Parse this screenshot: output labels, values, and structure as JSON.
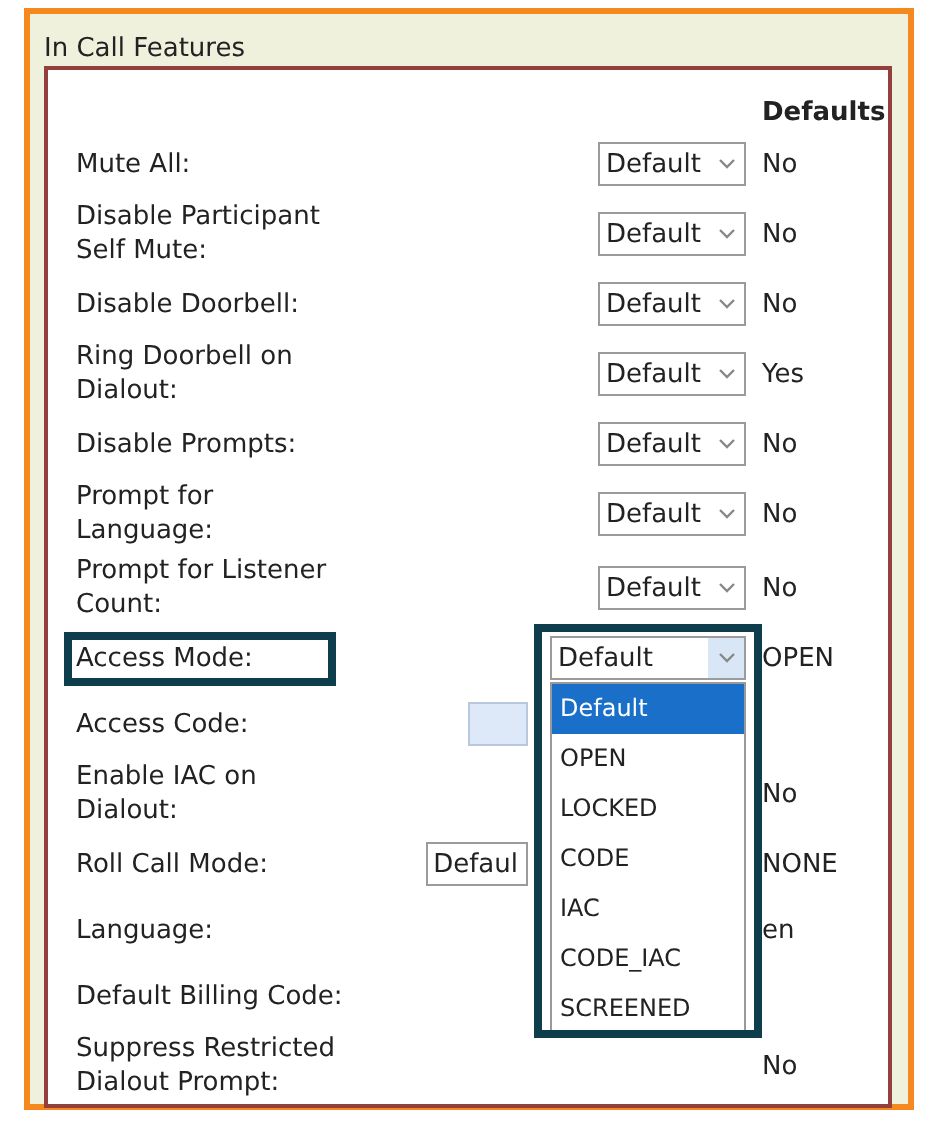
{
  "section": {
    "title": "In Call Features",
    "defaults_heading": "Defaults"
  },
  "rows": [
    {
      "label": "Mute All:",
      "kind": "select",
      "value": "Default",
      "default": "No"
    },
    {
      "label": "Disable Participant\nSelf Mute:",
      "kind": "select",
      "value": "Default",
      "default": "No"
    },
    {
      "label": "Disable Doorbell:",
      "kind": "select",
      "value": "Default",
      "default": "No"
    },
    {
      "label": "Ring Doorbell on\nDialout:",
      "kind": "select",
      "value": "Default",
      "default": "Yes"
    },
    {
      "label": "Disable Prompts:",
      "kind": "select",
      "value": "Default",
      "default": "No"
    },
    {
      "label": "Prompt for\nLanguage:",
      "kind": "select",
      "value": "Default",
      "default": "No"
    },
    {
      "label": "Prompt for Listener\nCount:",
      "kind": "select",
      "value": "Default",
      "default": "No"
    },
    {
      "label": "Access Mode:",
      "kind": "open-select",
      "highlighted": true,
      "value": "Default",
      "default": "OPEN",
      "options": [
        {
          "label": "Default",
          "selected": true
        },
        {
          "label": "OPEN",
          "selected": false
        },
        {
          "label": "LOCKED",
          "selected": false
        },
        {
          "label": "CODE",
          "selected": false
        },
        {
          "label": "IAC",
          "selected": false
        },
        {
          "label": "CODE_IAC",
          "selected": false
        },
        {
          "label": "SCREENED",
          "selected": false
        }
      ]
    },
    {
      "label": "Access Code:",
      "kind": "text"
    },
    {
      "label": "Enable IAC on\nDialout:",
      "kind": "none",
      "default": "No"
    },
    {
      "label": "Roll Call Mode:",
      "kind": "covered-select",
      "value": "Defaul",
      "default": "NONE"
    },
    {
      "label": "Language:",
      "kind": "none",
      "default": "en"
    },
    {
      "label": "Default Billing Code:",
      "kind": "none"
    },
    {
      "label": "Suppress Restricted\nDialout Prompt:",
      "kind": "none",
      "default": "No"
    }
  ]
}
